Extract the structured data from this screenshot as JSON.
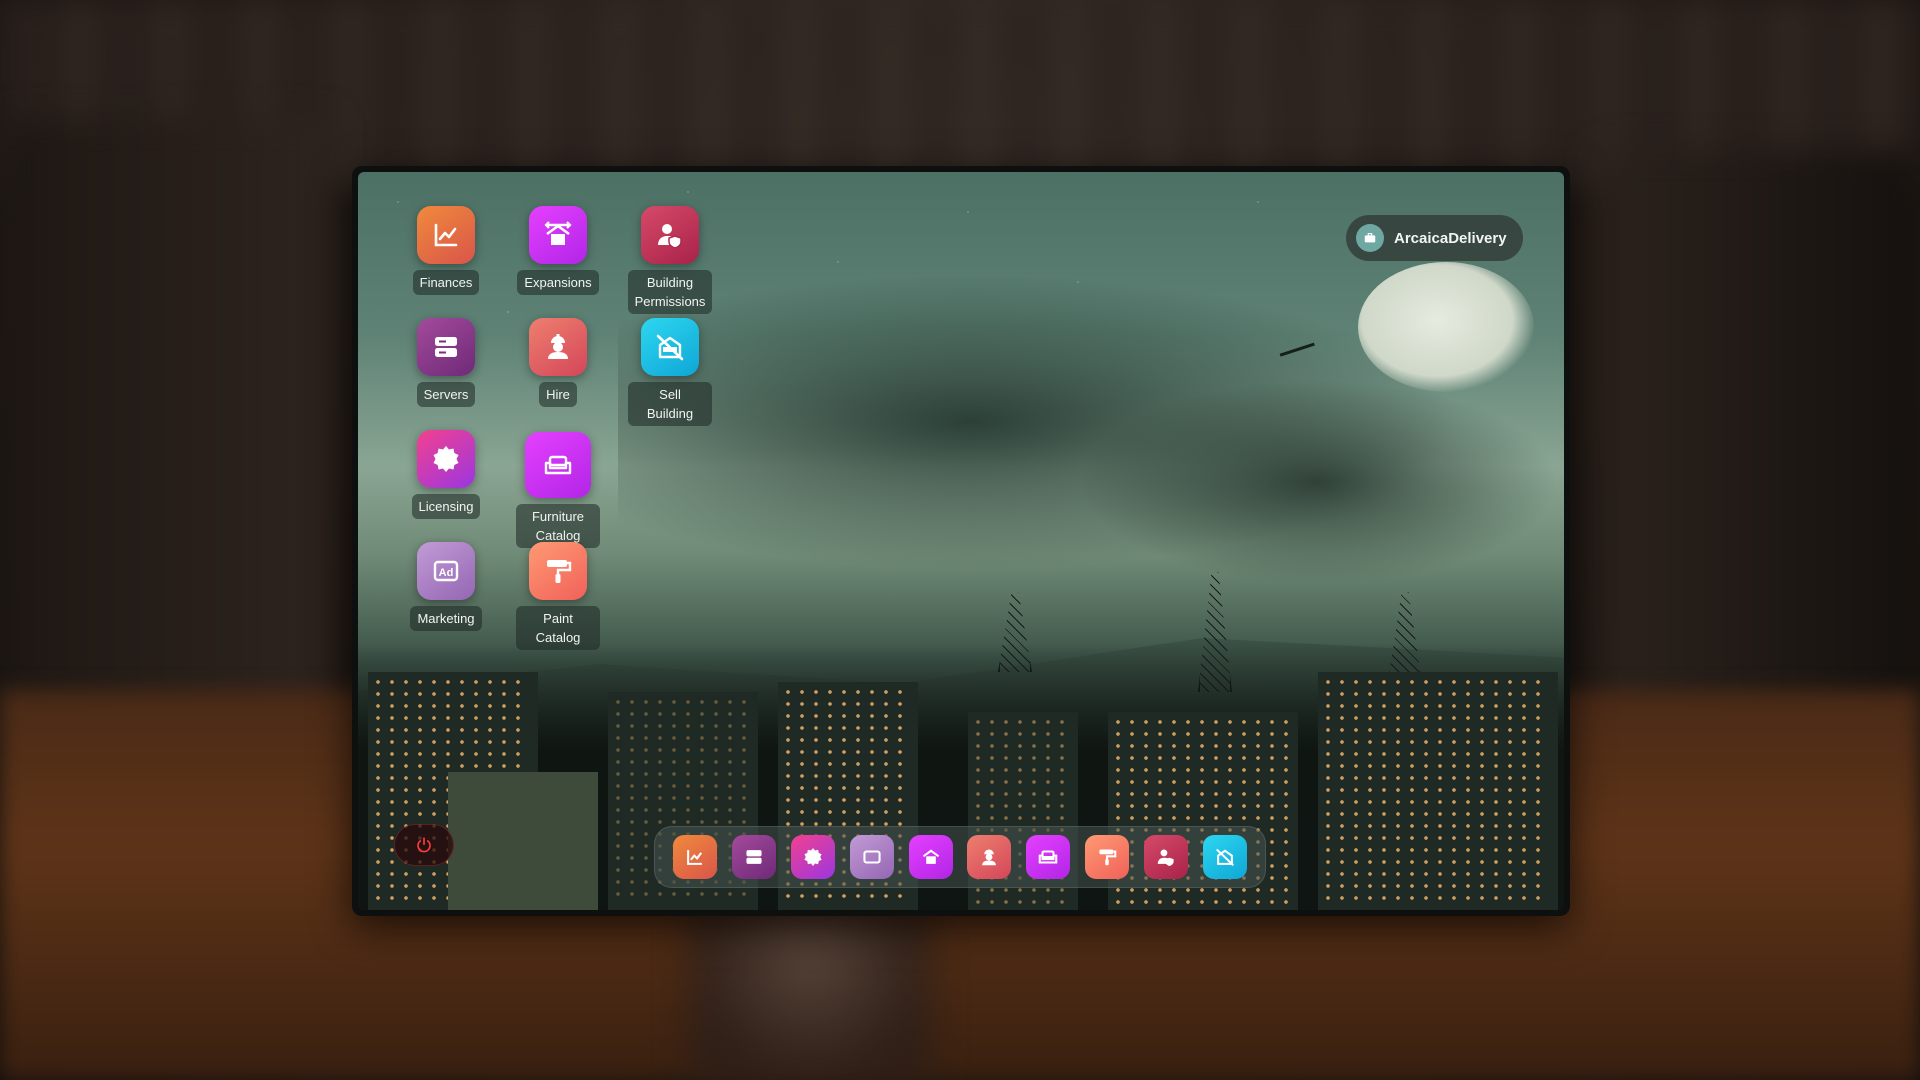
{
  "desktop": {
    "icons": [
      {
        "label": "Finances",
        "icon": "chart-line-icon"
      },
      {
        "label": "Expansions",
        "icon": "expand-building-icon"
      },
      {
        "label": "Building Permissions",
        "icon": "user-shield-icon"
      },
      {
        "label": "Servers",
        "icon": "server-icon"
      },
      {
        "label": "Hire",
        "icon": "worker-icon"
      },
      {
        "label": "Sell Building",
        "icon": "sell-building-icon"
      },
      {
        "label": "Licensing",
        "icon": "badge-seal-icon"
      },
      {
        "label": "Furniture Catalog",
        "icon": "sofa-icon"
      },
      {
        "label": "Marketing",
        "icon": "ad-icon"
      },
      {
        "label": "Paint Catalog",
        "icon": "paint-roller-icon"
      }
    ]
  },
  "user": {
    "name": "ArcaicaDelivery",
    "icon": "briefcase-icon"
  },
  "power": {
    "icon": "power-icon",
    "color": "#ff3b3b"
  },
  "dock": {
    "items": [
      {
        "icon": "chart-line-icon",
        "target": "Finances"
      },
      {
        "icon": "server-icon",
        "target": "Servers"
      },
      {
        "icon": "badge-seal-icon",
        "target": "Licensing"
      },
      {
        "icon": "ad-icon",
        "target": "Marketing"
      },
      {
        "icon": "expand-building-icon",
        "target": "Expansions"
      },
      {
        "icon": "worker-icon",
        "target": "Hire"
      },
      {
        "icon": "sofa-icon",
        "target": "Furniture Catalog"
      },
      {
        "icon": "paint-roller-icon",
        "target": "Paint Catalog"
      },
      {
        "icon": "user-shield-icon",
        "target": "Building Permissions"
      },
      {
        "icon": "sell-building-icon",
        "target": "Sell Building"
      }
    ]
  }
}
